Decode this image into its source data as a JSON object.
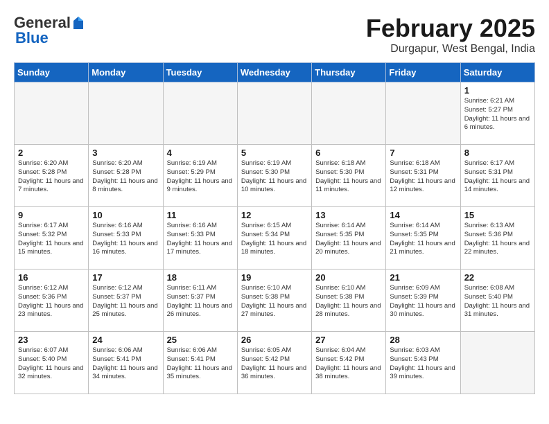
{
  "header": {
    "logo_general": "General",
    "logo_blue": "Blue",
    "month_title": "February 2025",
    "location": "Durgapur, West Bengal, India"
  },
  "days_of_week": [
    "Sunday",
    "Monday",
    "Tuesday",
    "Wednesday",
    "Thursday",
    "Friday",
    "Saturday"
  ],
  "weeks": [
    [
      {
        "day": "",
        "content": ""
      },
      {
        "day": "",
        "content": ""
      },
      {
        "day": "",
        "content": ""
      },
      {
        "day": "",
        "content": ""
      },
      {
        "day": "",
        "content": ""
      },
      {
        "day": "",
        "content": ""
      },
      {
        "day": "1",
        "content": "Sunrise: 6:21 AM\nSunset: 5:27 PM\nDaylight: 11 hours and 6 minutes."
      }
    ],
    [
      {
        "day": "2",
        "content": "Sunrise: 6:20 AM\nSunset: 5:28 PM\nDaylight: 11 hours and 7 minutes."
      },
      {
        "day": "3",
        "content": "Sunrise: 6:20 AM\nSunset: 5:28 PM\nDaylight: 11 hours and 8 minutes."
      },
      {
        "day": "4",
        "content": "Sunrise: 6:19 AM\nSunset: 5:29 PM\nDaylight: 11 hours and 9 minutes."
      },
      {
        "day": "5",
        "content": "Sunrise: 6:19 AM\nSunset: 5:30 PM\nDaylight: 11 hours and 10 minutes."
      },
      {
        "day": "6",
        "content": "Sunrise: 6:18 AM\nSunset: 5:30 PM\nDaylight: 11 hours and 11 minutes."
      },
      {
        "day": "7",
        "content": "Sunrise: 6:18 AM\nSunset: 5:31 PM\nDaylight: 11 hours and 12 minutes."
      },
      {
        "day": "8",
        "content": "Sunrise: 6:17 AM\nSunset: 5:31 PM\nDaylight: 11 hours and 14 minutes."
      }
    ],
    [
      {
        "day": "9",
        "content": "Sunrise: 6:17 AM\nSunset: 5:32 PM\nDaylight: 11 hours and 15 minutes."
      },
      {
        "day": "10",
        "content": "Sunrise: 6:16 AM\nSunset: 5:33 PM\nDaylight: 11 hours and 16 minutes."
      },
      {
        "day": "11",
        "content": "Sunrise: 6:16 AM\nSunset: 5:33 PM\nDaylight: 11 hours and 17 minutes."
      },
      {
        "day": "12",
        "content": "Sunrise: 6:15 AM\nSunset: 5:34 PM\nDaylight: 11 hours and 18 minutes."
      },
      {
        "day": "13",
        "content": "Sunrise: 6:14 AM\nSunset: 5:35 PM\nDaylight: 11 hours and 20 minutes."
      },
      {
        "day": "14",
        "content": "Sunrise: 6:14 AM\nSunset: 5:35 PM\nDaylight: 11 hours and 21 minutes."
      },
      {
        "day": "15",
        "content": "Sunrise: 6:13 AM\nSunset: 5:36 PM\nDaylight: 11 hours and 22 minutes."
      }
    ],
    [
      {
        "day": "16",
        "content": "Sunrise: 6:12 AM\nSunset: 5:36 PM\nDaylight: 11 hours and 23 minutes."
      },
      {
        "day": "17",
        "content": "Sunrise: 6:12 AM\nSunset: 5:37 PM\nDaylight: 11 hours and 25 minutes."
      },
      {
        "day": "18",
        "content": "Sunrise: 6:11 AM\nSunset: 5:37 PM\nDaylight: 11 hours and 26 minutes."
      },
      {
        "day": "19",
        "content": "Sunrise: 6:10 AM\nSunset: 5:38 PM\nDaylight: 11 hours and 27 minutes."
      },
      {
        "day": "20",
        "content": "Sunrise: 6:10 AM\nSunset: 5:38 PM\nDaylight: 11 hours and 28 minutes."
      },
      {
        "day": "21",
        "content": "Sunrise: 6:09 AM\nSunset: 5:39 PM\nDaylight: 11 hours and 30 minutes."
      },
      {
        "day": "22",
        "content": "Sunrise: 6:08 AM\nSunset: 5:40 PM\nDaylight: 11 hours and 31 minutes."
      }
    ],
    [
      {
        "day": "23",
        "content": "Sunrise: 6:07 AM\nSunset: 5:40 PM\nDaylight: 11 hours and 32 minutes."
      },
      {
        "day": "24",
        "content": "Sunrise: 6:06 AM\nSunset: 5:41 PM\nDaylight: 11 hours and 34 minutes."
      },
      {
        "day": "25",
        "content": "Sunrise: 6:06 AM\nSunset: 5:41 PM\nDaylight: 11 hours and 35 minutes."
      },
      {
        "day": "26",
        "content": "Sunrise: 6:05 AM\nSunset: 5:42 PM\nDaylight: 11 hours and 36 minutes."
      },
      {
        "day": "27",
        "content": "Sunrise: 6:04 AM\nSunset: 5:42 PM\nDaylight: 11 hours and 38 minutes."
      },
      {
        "day": "28",
        "content": "Sunrise: 6:03 AM\nSunset: 5:43 PM\nDaylight: 11 hours and 39 minutes."
      },
      {
        "day": "",
        "content": ""
      }
    ]
  ]
}
